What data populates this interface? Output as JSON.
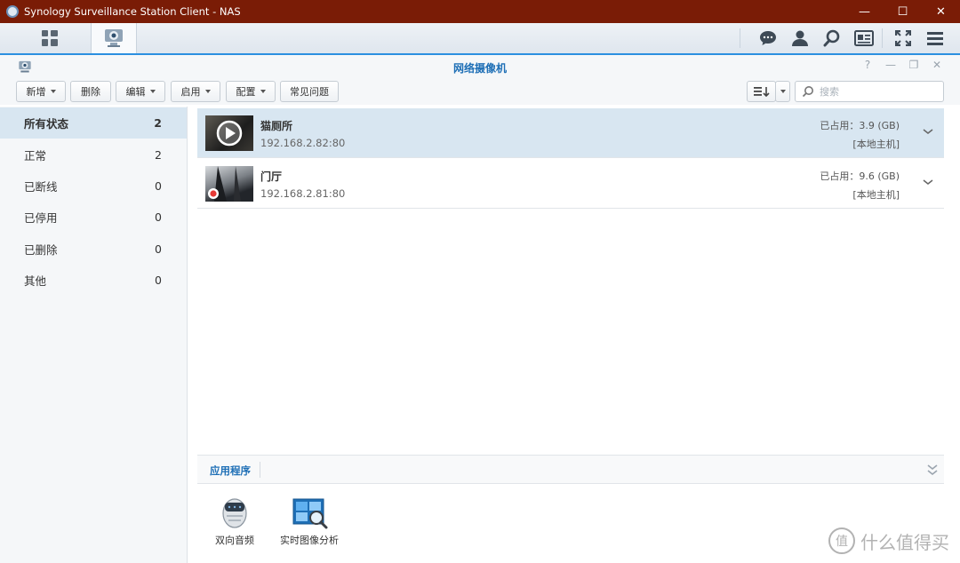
{
  "window": {
    "title": "Synology Surveillance Station Client - NAS",
    "min_glyph": "—",
    "max_glyph": "☐",
    "close_glyph": "✕"
  },
  "taskbar": {
    "tabs": [
      {
        "icon": "dashboard-icon"
      },
      {
        "icon": "ip-camera-icon"
      }
    ],
    "right_icons": [
      "chat-icon",
      "user-icon",
      "search-icon",
      "id-card-icon",
      "fullscreen-icon",
      "menu-icon"
    ]
  },
  "header": {
    "title": "网络摄像机",
    "help_glyph": "?",
    "min_glyph": "—",
    "restore_glyph": "❐",
    "close_glyph": "✕"
  },
  "toolbar": {
    "add": "新增",
    "delete": "删除",
    "edit": "编辑",
    "enable": "启用",
    "config": "配置",
    "faq": "常见问题",
    "search_placeholder": "搜索"
  },
  "sidebar": {
    "items": [
      {
        "label": "所有状态",
        "count": "2",
        "active": true
      },
      {
        "label": "正常",
        "count": "2"
      },
      {
        "label": "已断线",
        "count": "0"
      },
      {
        "label": "已停用",
        "count": "0"
      },
      {
        "label": "已删除",
        "count": "0"
      },
      {
        "label": "其他",
        "count": "0"
      }
    ]
  },
  "cameras": [
    {
      "name": "猫厕所",
      "ip": "192.168.2.82:80",
      "usage": "已占用：3.9 (GB)",
      "host": "[本地主机]",
      "status": "play"
    },
    {
      "name": "门厅",
      "ip": "192.168.2.81:80",
      "usage": "已占用：9.6 (GB)",
      "host": "[本地主机]",
      "status": "recording"
    }
  ],
  "apps": {
    "tab_label": "应用程序",
    "items": [
      {
        "label": "双向音频",
        "icon": "two-way-audio-icon"
      },
      {
        "label": "实时图像分析",
        "icon": "live-analytics-icon"
      }
    ]
  },
  "watermark": {
    "glyph": "值",
    "text": "什么值得买"
  },
  "colors": {
    "titlebar": "#7a1c06",
    "accent": "#1e6fb6",
    "selected_row": "#d8e6f1"
  }
}
